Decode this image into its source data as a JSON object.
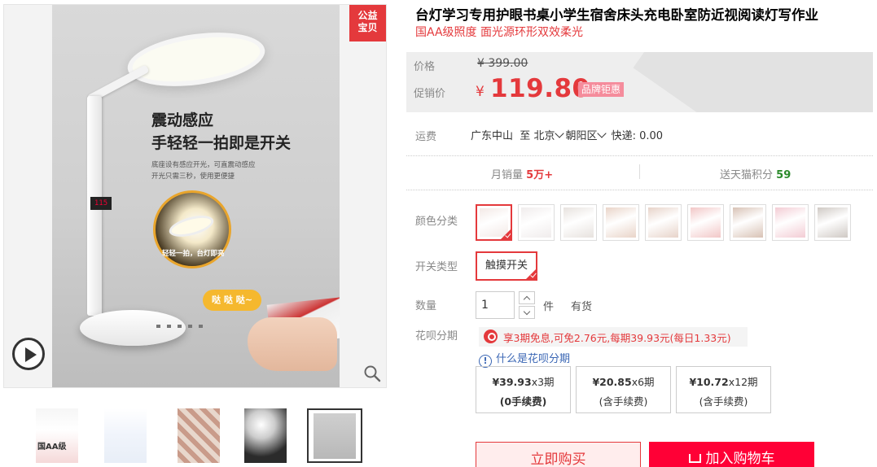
{
  "gallery": {
    "badge": "公益\n宝贝",
    "promo_title_1": "震动感应",
    "promo_title_2": "手轻轻一拍即是开关",
    "promo_sub_1": "底座设有感应开光，可直震动感应",
    "promo_sub_2": "开光只需三秒，使用更便捷",
    "circle_caption": "轻轻一拍，台灯即亮",
    "knock_label": "哒 哒 哒~",
    "display_readout": "115",
    "thumb1_text": "国AA级",
    "thumb_count": 5,
    "selected_thumb": 5
  },
  "product": {
    "title": "台灯学习专用护眼书桌小学生宿舍床头充电卧室防近视阅读灯写作业",
    "subtitle": "国AA级照度 面光源环形双效柔光"
  },
  "price": {
    "orig_label": "价格",
    "orig_value": "¥ 399.00",
    "promo_label": "促销价",
    "currency": "¥",
    "current": "119.80",
    "deal_tag": "品牌钜惠"
  },
  "shipping": {
    "label": "运费",
    "from": "广东中山",
    "to_prefix": "至",
    "city": "北京",
    "district": "朝阳区",
    "method": "快递: 0.00"
  },
  "stats": {
    "sales_label": "月销量",
    "sales_value": "5万+",
    "points_label": "送天猫积分",
    "points_value": "59"
  },
  "color": {
    "label": "颜色分类",
    "selected_index": 0,
    "swatch_colors": [
      "#f3e9e6",
      "#f0ecec",
      "#e7e2de",
      "#e9d4c8",
      "#e7d3c9",
      "#f2c7c7",
      "#d8c2b5",
      "#f3ccd4",
      "#cfc9c4"
    ]
  },
  "switch_type": {
    "label": "开关类型",
    "option": "触摸开关"
  },
  "quantity": {
    "label": "数量",
    "value": "1",
    "unit": "件",
    "stock": "有货"
  },
  "huabei": {
    "label": "花呗分期",
    "promo": "享3期免息,可免2.76元,每期39.93元(每日1.33元)",
    "help_link": "什么是花呗分期",
    "plans": [
      {
        "amount": "¥39.93",
        "periods": "x3期",
        "fee": "(0手续费)"
      },
      {
        "amount": "¥20.85",
        "periods": "x6期",
        "fee": "(含手续费)"
      },
      {
        "amount": "¥10.72",
        "periods": "x12期",
        "fee": "(含手续费)"
      }
    ]
  },
  "actions": {
    "buy_now": "立即购买",
    "add_to_cart": "加入购物车"
  },
  "colors": {
    "accent": "#e4393c",
    "cart_button": "#ff0036",
    "link": "#3a66b4"
  }
}
